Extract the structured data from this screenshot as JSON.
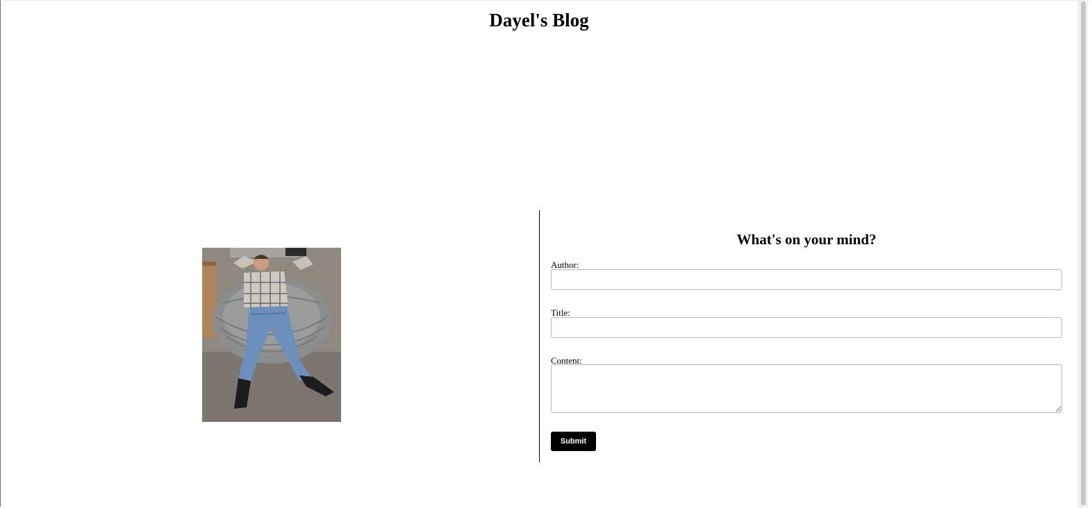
{
  "header": {
    "title": "Dayel's Blog"
  },
  "hero_image": {
    "icon": "photo-man-lying-on-bean-bag"
  },
  "form": {
    "heading": "What's on your mind?",
    "author_label": "Author:",
    "author_value": "",
    "title_label": "Title:",
    "title_value": "",
    "content_label": "Content:",
    "content_value": "",
    "submit_label": "Submit"
  },
  "colors": {
    "accent": "#000000",
    "background": "#ffffff",
    "input_border": "#b8b8b8"
  }
}
